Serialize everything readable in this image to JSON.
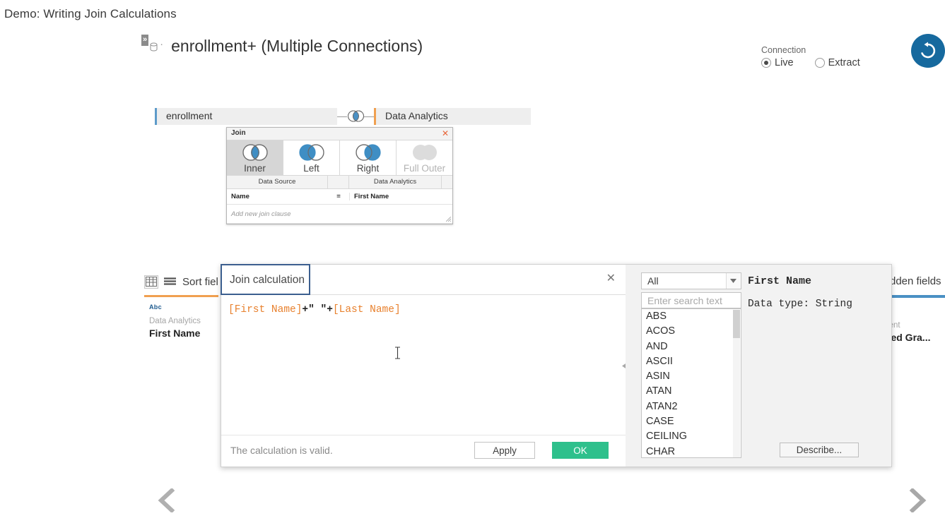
{
  "slide": {
    "title": "Demo: Writing Join Calculations"
  },
  "data_source": {
    "expand_icon": "double-chevron-right-icon",
    "db_icon": "database-icon",
    "name": "enrollment+ (Multiple Connections)"
  },
  "connection": {
    "label": "Connection",
    "options": [
      {
        "label": "Live",
        "selected": true
      },
      {
        "label": "Extract",
        "selected": false
      }
    ]
  },
  "refresh": {
    "icon": "refresh-icon",
    "color": "#16699e"
  },
  "canvas": {
    "left_table": "enrollment",
    "right_table": "Data Analytics",
    "left_accent": "#5d9bc9",
    "right_accent": "#f0a050",
    "join_icon": "venn-inner-join-icon"
  },
  "join_popup": {
    "title": "Join",
    "close_icon": "close-icon",
    "types": [
      {
        "label": "Inner",
        "icon": "venn-inner-icon",
        "active": true,
        "disabled": false
      },
      {
        "label": "Left",
        "icon": "venn-left-icon",
        "active": false,
        "disabled": false
      },
      {
        "label": "Right",
        "icon": "venn-right-icon",
        "active": false,
        "disabled": false
      },
      {
        "label": "Full Outer",
        "icon": "venn-full-outer-icon",
        "active": false,
        "disabled": true
      }
    ],
    "columns": [
      "Data Source",
      "Data Analytics"
    ],
    "clauses": [
      {
        "left": "Name",
        "operator": "=",
        "right": "First Name"
      }
    ],
    "add_clause_placeholder": "Add new join clause",
    "resize_icon": "resize-grip-icon"
  },
  "grid": {
    "view_icon": "grid-view-icon",
    "list_icon": "list-view-icon",
    "sort_fields_label": "Sort fiel",
    "hidden_fields_label": "dden fields",
    "left_column": {
      "cap_color": "#f0a050",
      "type_tag": "Abc",
      "source": "Data Analytics",
      "name": "First Name"
    },
    "right_column": {
      "cap_color": "#4a90c4",
      "source": "ment",
      "name": "cted Gra..."
    }
  },
  "calc_dialog": {
    "tab_label": "Join calculation",
    "close_icon": "close-icon",
    "formula": {
      "tokens": [
        {
          "text": "[First Name]",
          "type": "field"
        },
        {
          "text": "+",
          "type": "op"
        },
        {
          "text": "\" \"",
          "type": "string"
        },
        {
          "text": "+",
          "type": "op"
        },
        {
          "text": "[Last Name]",
          "type": "field"
        }
      ]
    },
    "cursor_icon": "i-beam-cursor-icon",
    "status": "The calculation is valid.",
    "apply_label": "Apply",
    "ok_label": "OK",
    "ok_color": "#2ec08c",
    "collapse_icon": "collapse-left-triangle-icon"
  },
  "function_panel": {
    "category_value": "All",
    "dropdown_icon": "chevron-down-icon",
    "search_placeholder": "Enter search text",
    "functions": [
      "ABS",
      "ACOS",
      "AND",
      "ASCII",
      "ASIN",
      "ATAN",
      "ATAN2",
      "CASE",
      "CEILING",
      "CHAR"
    ],
    "detail_name": "First Name",
    "detail_type": "Data type: String",
    "describe_label": "Describe..."
  },
  "navigation": {
    "prev_icon": "chevron-left-icon",
    "next_icon": "chevron-right-icon"
  }
}
